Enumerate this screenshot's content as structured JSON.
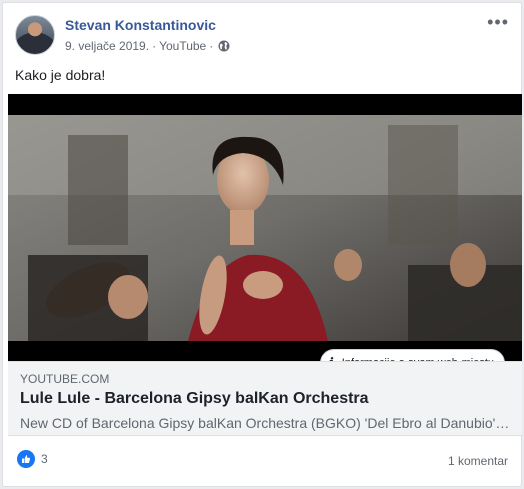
{
  "post": {
    "author": "Stevan Konstantinovic",
    "date": "9. veljače 2019.",
    "separator": "·",
    "source": "YouTube",
    "separator2": "·",
    "text": "Kako je dobra!"
  },
  "icons": {
    "audience": "globe-icon",
    "more": "more-options-icon",
    "info": "info-icon",
    "reaction": "like-icon"
  },
  "video": {
    "info_label": "Informacije o ovom web-mjestu"
  },
  "link": {
    "domain": "YOUTUBE.COM",
    "title": "Lule Lule - Barcelona Gipsy balKan Orchestra",
    "description": "New CD of Barcelona Gipsy balKan Orchestra (BGKO) 'Del Ebro al Danubio' out now ..."
  },
  "footer": {
    "reaction_count": "3",
    "comment_count": "1 komentar"
  },
  "colors": {
    "author": "#385898",
    "like": "#1877f2",
    "link_bg": "#f2f3f5"
  }
}
